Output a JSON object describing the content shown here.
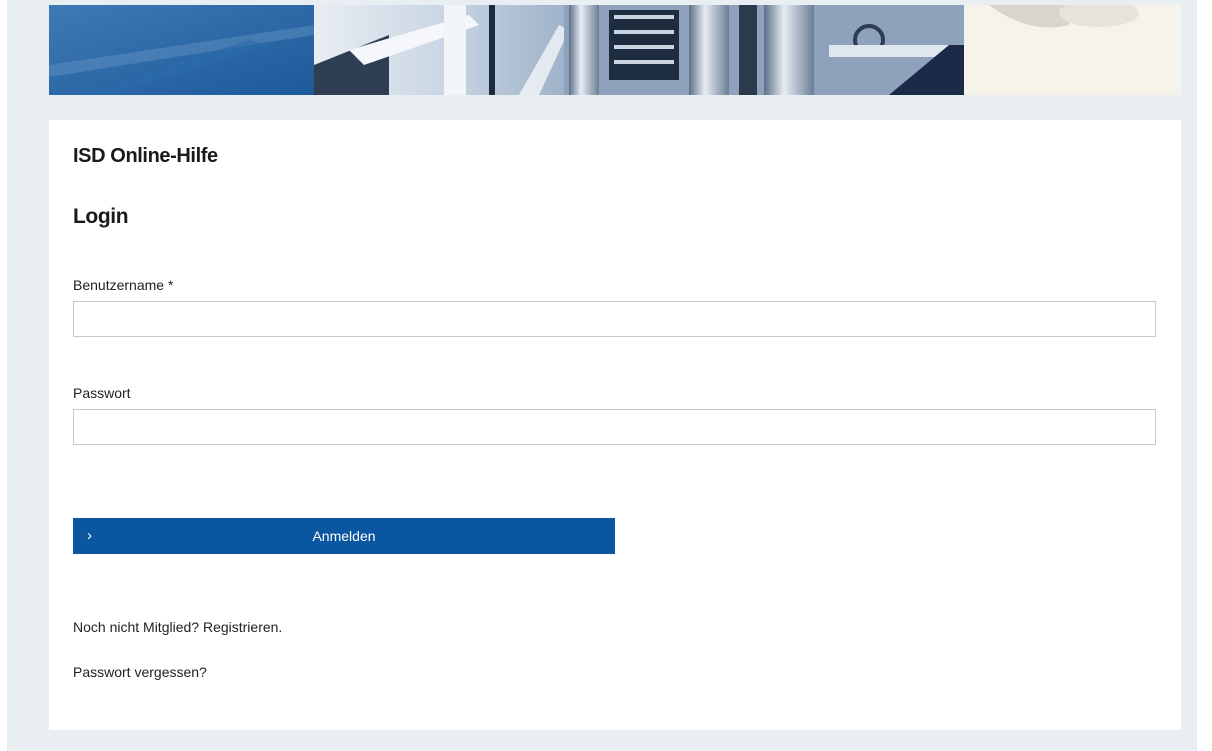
{
  "header": {
    "site_title": "ISD Online-Hilfe"
  },
  "login": {
    "title": "Login",
    "username": {
      "label": "Benutzername *",
      "value": "",
      "placeholder": ""
    },
    "password": {
      "label": "Passwort",
      "value": "",
      "placeholder": ""
    },
    "submit_label": "Anmelden",
    "submit_icon": "chevron-right-icon",
    "register_prompt": "Noch nicht Mitglied?",
    "register_link": "Registrieren.",
    "forgot_password": "Passwort vergessen?"
  },
  "colors": {
    "primary": "#0a56a0",
    "page_background": "#e9eef3",
    "card_background": "#ffffff",
    "text": "#222222"
  }
}
